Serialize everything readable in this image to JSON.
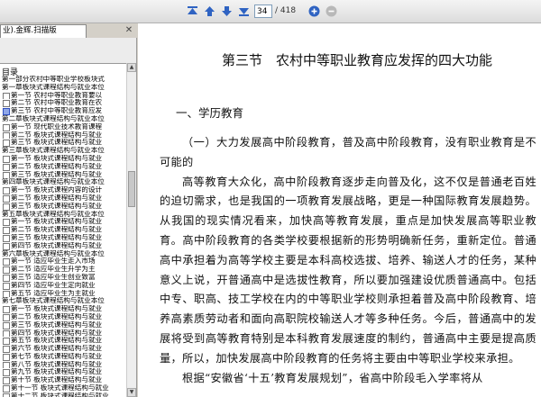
{
  "toolbar": {
    "current_page": "34",
    "total_pages": "/ 418",
    "icons": [
      "first-page-icon",
      "prev-page-icon",
      "next-page-icon",
      "last-page-icon",
      "zoom-in-icon",
      "zoom-out-icon"
    ],
    "accent_color": "#3a6fc4"
  },
  "left_panel": {
    "tab_label": "业).金辉.扫描版",
    "toc_header": "目录",
    "toc": [
      {
        "level": 0,
        "label": "第一部分农村中等职业学校板块式"
      },
      {
        "level": 0,
        "label": "第一章板块式课程结构与就业本位"
      },
      {
        "level": 1,
        "label": "第一节 农村中等职业教育要以"
      },
      {
        "level": 1,
        "label": "第二节 农村中等职业教育在农"
      },
      {
        "level": 1,
        "label": "第三节 农村中等职业教育应发",
        "selected": true
      },
      {
        "level": 0,
        "label": "第二章板块式课程结构与就业本位"
      },
      {
        "level": 1,
        "label": "第一节 现代职业技术教育课程"
      },
      {
        "level": 1,
        "label": "第二节 板块式课程结构与就业"
      },
      {
        "level": 1,
        "label": "第三节 板块式课程结构与就业"
      },
      {
        "level": 0,
        "label": "第三章板块式课程结构与就业本位"
      },
      {
        "level": 1,
        "label": "第一节 板块式课程结构与就业"
      },
      {
        "level": 1,
        "label": "第二节 板块式课程结构与就业"
      },
      {
        "level": 1,
        "label": "第三节 板块式课程结构与就业"
      },
      {
        "level": 0,
        "label": "第四章板块式课程结构与就业本位"
      },
      {
        "level": 1,
        "label": "第一节 板块式课程内容的设计"
      },
      {
        "level": 1,
        "label": "第二节 板块式课程结构与就业"
      },
      {
        "level": 1,
        "label": "第三节 板块式课程结构与就业"
      },
      {
        "level": 0,
        "label": "第五章板块式课程结构与就业本位"
      },
      {
        "level": 1,
        "label": "第一节 板块式课程结构与就业"
      },
      {
        "level": 1,
        "label": "第二节 板块式课程结构与就业"
      },
      {
        "level": 1,
        "label": "第三节 板块式课程结构与就业"
      },
      {
        "level": 1,
        "label": "第四节 板块式课程结构与就业"
      },
      {
        "level": 0,
        "label": "第六章板块式课程结构与就业本位"
      },
      {
        "level": 1,
        "label": "第一节 适应毕业生走入市场"
      },
      {
        "level": 1,
        "label": "第二节 适应毕业生升学为主"
      },
      {
        "level": 1,
        "label": "第三节 适应毕业生创业致富"
      },
      {
        "level": 1,
        "label": "第四节 适应毕业生定向就业"
      },
      {
        "level": 1,
        "label": "第五节 适应毕业生为主就业"
      },
      {
        "level": 0,
        "label": "第七章板块式课程结构与就业本位"
      },
      {
        "level": 1,
        "label": "第一节 板块式课程结构与就业"
      },
      {
        "level": 1,
        "label": "第二节 板块式课程结构与就业"
      },
      {
        "level": 1,
        "label": "第三节 板块式课程结构与就业"
      },
      {
        "level": 1,
        "label": "第四节 板块式课程结构与就业"
      },
      {
        "level": 1,
        "label": "第五节 板块式课程结构与就业"
      },
      {
        "level": 1,
        "label": "第六节 板块式课程结构与就业"
      },
      {
        "level": 1,
        "label": "第七节 板块式课程结构与就业"
      },
      {
        "level": 1,
        "label": "第八节 板块式课程结构与就业"
      },
      {
        "level": 1,
        "label": "第九节 板块式课程结构与就业"
      },
      {
        "level": 1,
        "label": "第十节 板块式课程结构与就业"
      },
      {
        "level": 1,
        "label": "第十一节 板块式课程结构与就业"
      },
      {
        "level": 1,
        "label": "第十二节 板块式课程结构与就业"
      }
    ]
  },
  "document": {
    "section_title": "第三节　农村中等职业教育应发挥的四大功能",
    "sub_heading": "一、学历教育",
    "paragraphs": [
      "（一）大力发展高中阶段教育，普及高中阶段教育，没有职业教育是不可能的",
      "高等教育大众化，高中阶段教育逐步走向普及化，这不仅是普通老百姓的迫切需求，也是我国的一项教育发展战略，更是一种国际教育发展趋势。从我国的现实情况看来，加快高等教育发展，重点是加快发展高等职业教育。高中阶段教育的各类学校要根据新的形势明确新任务，重新定位。普通高中承担着为高等学校主要是本科高校选拔、培养、输送人才的任务，某种意义上说，开普通高中是选拔性教育，所以要加强建设优质普通高中。包括中专、职高、技工学校在内的中等职业学校则承担着普及高中阶段教育、培养高素质劳动者和面向高职院校输送人才等多种任务。今后，普通高中的发展将受到高等教育特别是本科教育发展速度的制约，普通高中主要是提高质量，所以，加快发展高中阶段教育的任务将主要由中等职业学校来承担。",
      "根据“安徽省‘十五’教育发展规划”，省高中阶段毛入学率将从"
    ]
  }
}
